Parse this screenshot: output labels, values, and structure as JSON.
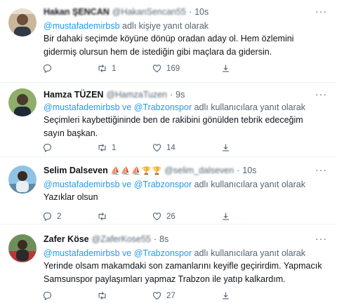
{
  "tweets": [
    {
      "name": "Hakan ŞENCAN",
      "handle": "@HakanSencan55",
      "dot": "·",
      "time": "10s",
      "reply_prefix": "",
      "reply_users": "@mustafademirbsb",
      "reply_suffix": " adlı kişiye yanıt olarak",
      "text": "Bir dahaki seçimde köyüne dönüp oradan aday ol. Hem özlemini gidermiş olursun hem de istediğin gibi maçlara da gidersin.",
      "reply_count": "",
      "retweet_count": "1",
      "like_count": "169"
    },
    {
      "name": "Hamza TÜZEN",
      "handle": "@HamzaTuzen",
      "dot": "·",
      "time": "9s",
      "reply_users": "@mustafademirbsb ve @Trabzonspor",
      "reply_suffix": " adlı kullanıcılara yanıt olarak",
      "text": "Seçimleri kaybettiğininde ben de rakibini gönülden tebrik edeceğim sayın başkan.",
      "reply_count": "",
      "retweet_count": "1",
      "like_count": "14"
    },
    {
      "name": "Selim Dalseven",
      "handle": "@selim_dalseven",
      "dot": "·",
      "time": "10s",
      "badges": [
        "⛵",
        "⛵",
        "⛵",
        "🏆",
        "🏆"
      ],
      "reply_users": "@mustafademirbsb ve @Trabzonspor",
      "reply_suffix": " adlı kullanıcılara yanıt olarak",
      "text": "Yazıklar olsun",
      "reply_count": "2",
      "retweet_count": "",
      "like_count": "26"
    },
    {
      "name": "Zafer Köse",
      "handle": "@ZaferKose55",
      "dot": "·",
      "time": "8s",
      "reply_users": "@mustafademirbsb ve @Trabzonspor",
      "reply_suffix": " adlı kullanıcılara yanıt olarak",
      "text": "Yerinde olsam makamdaki son zamanlarını keyifle geçirirdim. Yapmacık Samsunspor paylaşımları yapmaz Trabzon ile yatıp kalkardım.",
      "reply_count": "",
      "retweet_count": "",
      "like_count": "27"
    }
  ],
  "icons": {
    "more": "more-icon",
    "reply": "reply-icon",
    "retweet": "retweet-icon",
    "like": "like-icon",
    "share": "share-icon"
  },
  "colors": {
    "link": "#1d9bf0",
    "muted": "#536471",
    "text": "#0f1419"
  }
}
